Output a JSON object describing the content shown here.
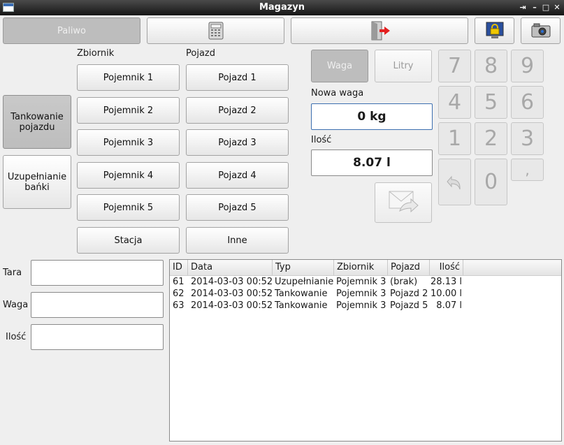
{
  "window": {
    "title": "Magazyn"
  },
  "toolbar": {
    "fuel_label": "Paliwo"
  },
  "columns": {
    "tank_header": "Zbiornik",
    "vehicle_header": "Pojazd"
  },
  "modes": {
    "refuel_vehicle": "Tankowanie pojazdu",
    "refill_can": "Uzupełnianie bańki"
  },
  "tanks": [
    "Pojemnik 1",
    "Pojemnik 2",
    "Pojemnik 3",
    "Pojemnik 4",
    "Pojemnik 5",
    "Stacja"
  ],
  "vehicles": [
    "Pojazd 1",
    "Pojazd 2",
    "Pojazd 3",
    "Pojazd 4",
    "Pojazd 5",
    "Inne"
  ],
  "measure": {
    "weight_btn": "Waga",
    "liters_btn": "Litry",
    "new_weight_label": "Nowa waga",
    "new_weight_value": "0 kg",
    "amount_label": "Ilość",
    "amount_value": "8.07 l"
  },
  "keypad": [
    "7",
    "8",
    "9",
    "4",
    "5",
    "6",
    "1",
    "2",
    "3",
    "0",
    ","
  ],
  "form": {
    "tara_label": "Tara",
    "waga_label": "Waga",
    "ilosc_label": "Ilość"
  },
  "table": {
    "headers": [
      "ID",
      "Data",
      "Typ",
      "Zbiornik",
      "Pojazd",
      "Ilość"
    ],
    "rows": [
      [
        "61",
        "2014-03-03 00:52",
        "Uzupełnianie",
        "Pojemnik 3",
        "(brak)",
        "28.13 l"
      ],
      [
        "62",
        "2014-03-03 00:52",
        "Tankowanie",
        "Pojemnik 3",
        "Pojazd 2",
        "10.00 l"
      ],
      [
        "63",
        "2014-03-03 00:52",
        "Tankowanie",
        "Pojemnik 3",
        "Pojazd 5",
        "8.07 l"
      ]
    ]
  },
  "icons": {
    "calculator": "calculator-icon",
    "exit": "exit-door-icon",
    "lock": "lock-screen-icon",
    "camera": "camera-icon",
    "send": "send-envelope-icon",
    "backspace": "undo-arrow-icon"
  }
}
